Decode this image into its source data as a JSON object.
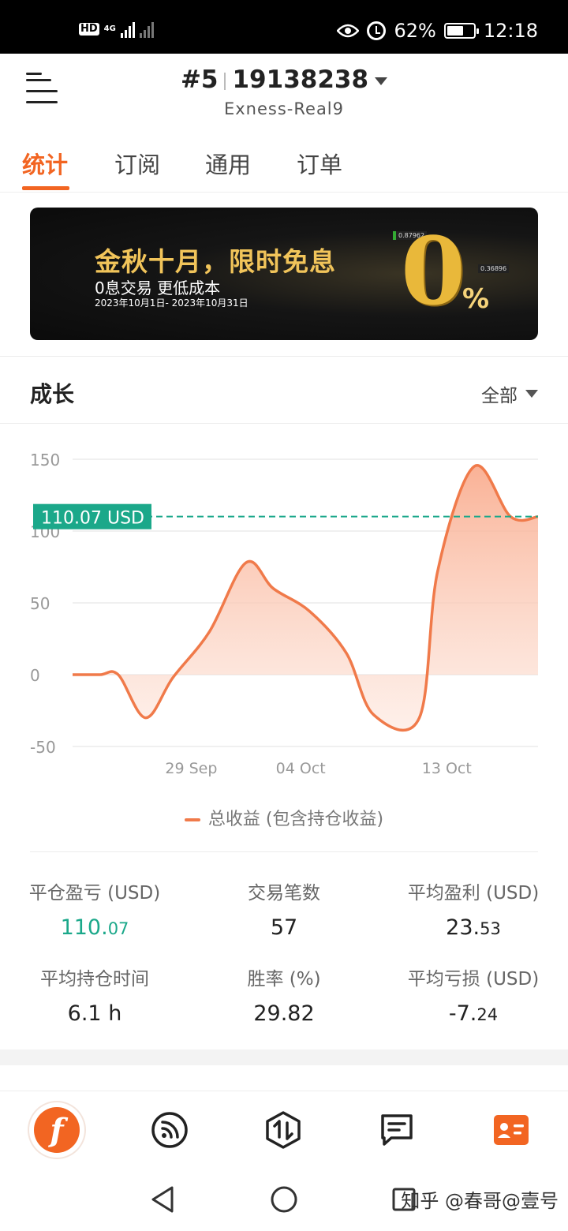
{
  "status_bar": {
    "hd": "HD",
    "network": "4G",
    "battery_percent": "62%",
    "battery_level": 0.62,
    "time": "12:18"
  },
  "header": {
    "account_num": "#5",
    "account_id": "19138238",
    "server": "Exness-Real9"
  },
  "tabs": [
    {
      "label": "统计",
      "active": true
    },
    {
      "label": "订阅",
      "active": false
    },
    {
      "label": "通用",
      "active": false
    },
    {
      "label": "订单",
      "active": false
    }
  ],
  "banner": {
    "headline": "金秋十月，限时免息",
    "subline": "0息交易 更低成本",
    "dates": "2023年10月1日- 2023年10月31日",
    "big_zero": "0",
    "percent": "%",
    "tick1": "0.87962",
    "tick2": "0.36896"
  },
  "growth": {
    "title": "成长",
    "range": "全部",
    "current_label": "110.07 USD"
  },
  "chart_data": {
    "type": "area",
    "y_ticks": [
      "150",
      "100",
      "50",
      "0",
      "-50"
    ],
    "ylim": [
      -50,
      150
    ],
    "x_labels": [
      "29 Sep",
      "04 Oct",
      "13 Oct"
    ],
    "x_label_index": [
      6.5,
      12.5,
      20.5
    ],
    "series": [
      {
        "name": "总收益 (包含持仓收益)",
        "values": [
          0,
          0,
          0,
          -30,
          -2,
          30,
          78,
          60,
          44,
          15,
          -28,
          -30,
          72,
          145,
          110,
          110
        ],
        "x_index": [
          0,
          1.5,
          2.5,
          4.0,
          5.5,
          7.5,
          9.5,
          11.0,
          13.0,
          15.0,
          16.5,
          19.0,
          20.0,
          22.0,
          24.0,
          25.5
        ]
      }
    ],
    "reference_line": 110.07,
    "grid": true,
    "colors": {
      "line": "#f07a4a",
      "fill": "#fcd2c0",
      "reference": "#1ba88a"
    }
  },
  "legend": "总收益 (包含持仓收益)",
  "stats": {
    "closed_pl_label": "平仓盈亏 (USD)",
    "closed_pl_main": "110.",
    "closed_pl_dec": "07",
    "trades_label": "交易笔数",
    "trades_value": "57",
    "avg_profit_label": "平均盈利 (USD)",
    "avg_profit_main": "23.",
    "avg_profit_dec": "53",
    "avg_hold_label": "平均持仓时间",
    "avg_hold_value": "6.1 h",
    "win_rate_label": "胜率 (%)",
    "win_rate_value": "29.82",
    "avg_loss_label": "平均亏损 (USD)",
    "avg_loss_main": "-7.",
    "avg_loss_dec": "24"
  },
  "bottom_nav": [
    {
      "icon": "f-logo-icon"
    },
    {
      "icon": "feed-icon"
    },
    {
      "icon": "trade-icon"
    },
    {
      "icon": "message-icon"
    },
    {
      "icon": "profile-card-icon"
    }
  ],
  "watermark": "知乎 @春哥@壹号",
  "colors": {
    "accent": "#f26522",
    "positive": "#1ba88a"
  }
}
